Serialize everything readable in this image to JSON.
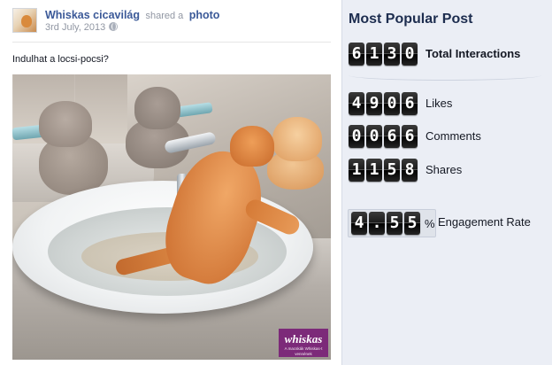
{
  "post": {
    "author": "Whiskas cicavilág",
    "shared_text": "shared a",
    "object": "photo",
    "date": "3rd July, 2013",
    "caption": "Indulhat a locsi-pocsi?",
    "brand_logo_text": "whiskas",
    "brand_tagline": "A macskák Whiskas-t vennének"
  },
  "panel": {
    "title": "Most Popular Post",
    "stats": [
      {
        "digits": [
          "6",
          "1",
          "3",
          "0"
        ],
        "label": "Total Interactions"
      },
      {
        "digits": [
          "4",
          "9",
          "0",
          "6"
        ],
        "label": "Likes"
      },
      {
        "digits": [
          "0",
          "0",
          "6",
          "6"
        ],
        "label": "Comments"
      },
      {
        "digits": [
          "1",
          "1",
          "5",
          "8"
        ],
        "label": "Shares"
      }
    ],
    "engagement": {
      "digits": [
        "4",
        ".",
        "5",
        "5"
      ],
      "unit": "%",
      "label": "Engagement Rate"
    }
  },
  "colors": {
    "link_blue": "#3b5998",
    "panel_bg": "#ebeef5",
    "brand_purple": "#7c2a79"
  },
  "icons": {
    "privacy": "globe-icon"
  }
}
